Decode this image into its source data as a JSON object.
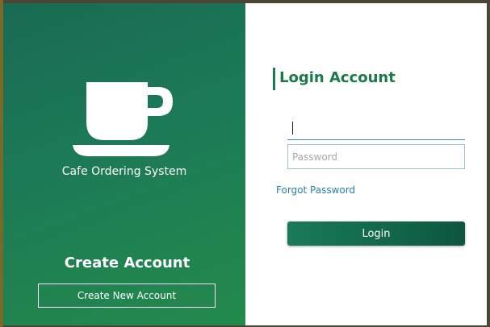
{
  "left_panel": {
    "icon": "coffee-cup-icon",
    "app_name": "Cafe Ordering System",
    "create_heading": "Create Account",
    "create_button_label": "Create New Account"
  },
  "login": {
    "title": "Login Account",
    "username_value": "",
    "password_placeholder": "Password",
    "forgot_label": "Forgot Password",
    "login_button_label": "Login"
  },
  "colors": {
    "brand_green": "#1c7a56",
    "link_blue": "#2a7fb8",
    "focus_blue": "#3a86c8"
  }
}
